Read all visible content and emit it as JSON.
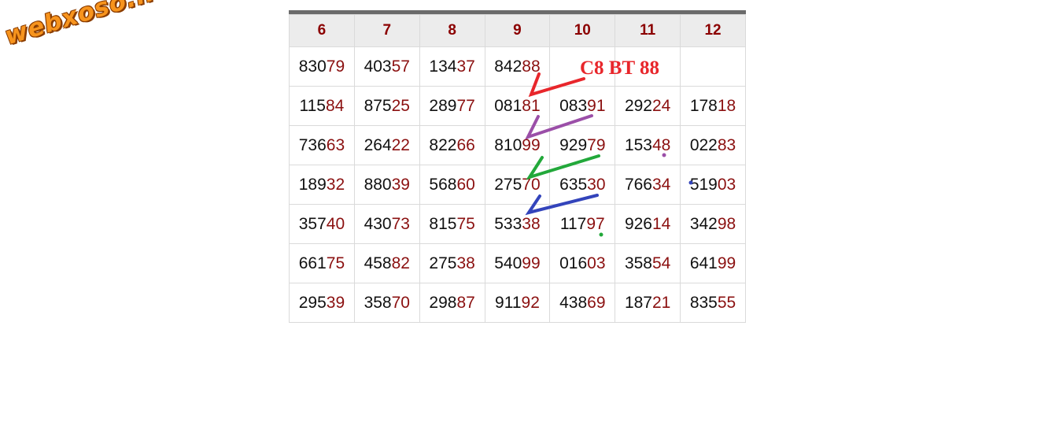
{
  "watermark": {
    "text": "webxoso.net"
  },
  "table": {
    "columns": [
      "6",
      "7",
      "8",
      "9",
      "10",
      "11",
      "12"
    ],
    "rows": [
      [
        "83079",
        "40357",
        "13437",
        "84288",
        "",
        "",
        ""
      ],
      [
        "11584",
        "87525",
        "28977",
        "08181",
        "08391",
        "29224",
        "17818"
      ],
      [
        "73663",
        "26422",
        "82266",
        "81099",
        "92979",
        "15348",
        "02283"
      ],
      [
        "18932",
        "88039",
        "56860",
        "27570",
        "63530",
        "76634",
        "51903"
      ],
      [
        "35740",
        "43073",
        "81575",
        "53338",
        "11797",
        "92614",
        "34298"
      ],
      [
        "66175",
        "45882",
        "27538",
        "54099",
        "01603",
        "35854",
        "64199"
      ],
      [
        "29539",
        "35870",
        "29887",
        "91192",
        "43869",
        "18721",
        "83555"
      ]
    ],
    "highlights": [
      [
        "none",
        "none",
        "none",
        "orange",
        "orange",
        "green",
        "none"
      ],
      [
        "none",
        "none",
        "none",
        "orange",
        "orange",
        "none",
        "green"
      ],
      [
        "green",
        "none",
        "none",
        "orange",
        "orange",
        "none",
        "none"
      ],
      [
        "none",
        "green",
        "none",
        "orange",
        "orange",
        "none",
        "none"
      ],
      [
        "none",
        "none",
        "none",
        "orange",
        "none",
        "none",
        "none"
      ],
      [
        "none",
        "none",
        "none",
        "none",
        "green",
        "none",
        "none"
      ],
      [
        "none",
        "none",
        "none",
        "none",
        "none",
        "green",
        "yellow"
      ]
    ]
  },
  "annotation": {
    "text": "C8 BT 88",
    "color": "#e8262b"
  },
  "stroke_colors": [
    "#e8262b",
    "#9b4fa8",
    "#22a83a",
    "#3344bb"
  ]
}
